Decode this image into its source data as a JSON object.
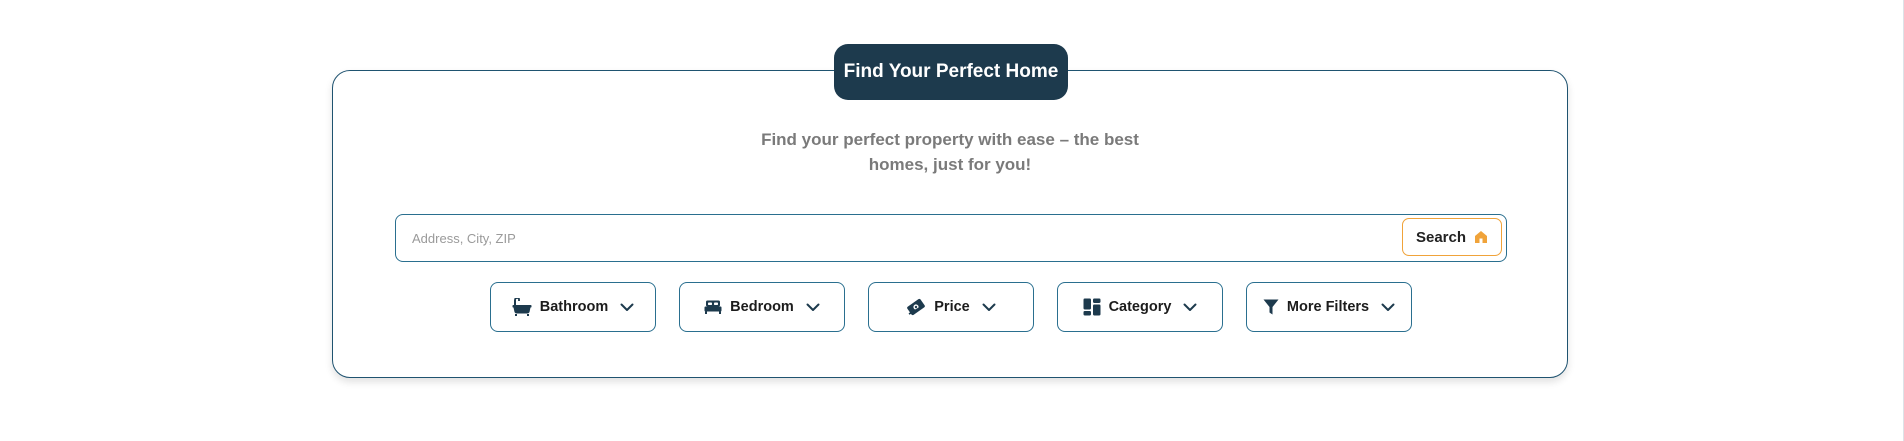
{
  "header": {
    "title": "Find Your Perfect Home",
    "subtitle_line1": "Find your perfect property with ease – the best",
    "subtitle_line2": "homes, just for you!"
  },
  "search": {
    "placeholder": "Address, City, ZIP",
    "value": "",
    "button_label": "Search",
    "button_icon": "home-icon"
  },
  "filters": [
    {
      "label": "Bathroom",
      "icon": "bathtub-icon"
    },
    {
      "label": "Bedroom",
      "icon": "bed-icon"
    },
    {
      "label": "Price",
      "icon": "price-tag-icon"
    },
    {
      "label": "Category",
      "icon": "category-grid-icon"
    },
    {
      "label": "More Filters",
      "icon": "funnel-icon"
    }
  ],
  "colors": {
    "primary": "#1d3a4d",
    "border": "#2a6f8f",
    "accent": "#f0a33a",
    "subtitle": "#7a7a7a"
  }
}
